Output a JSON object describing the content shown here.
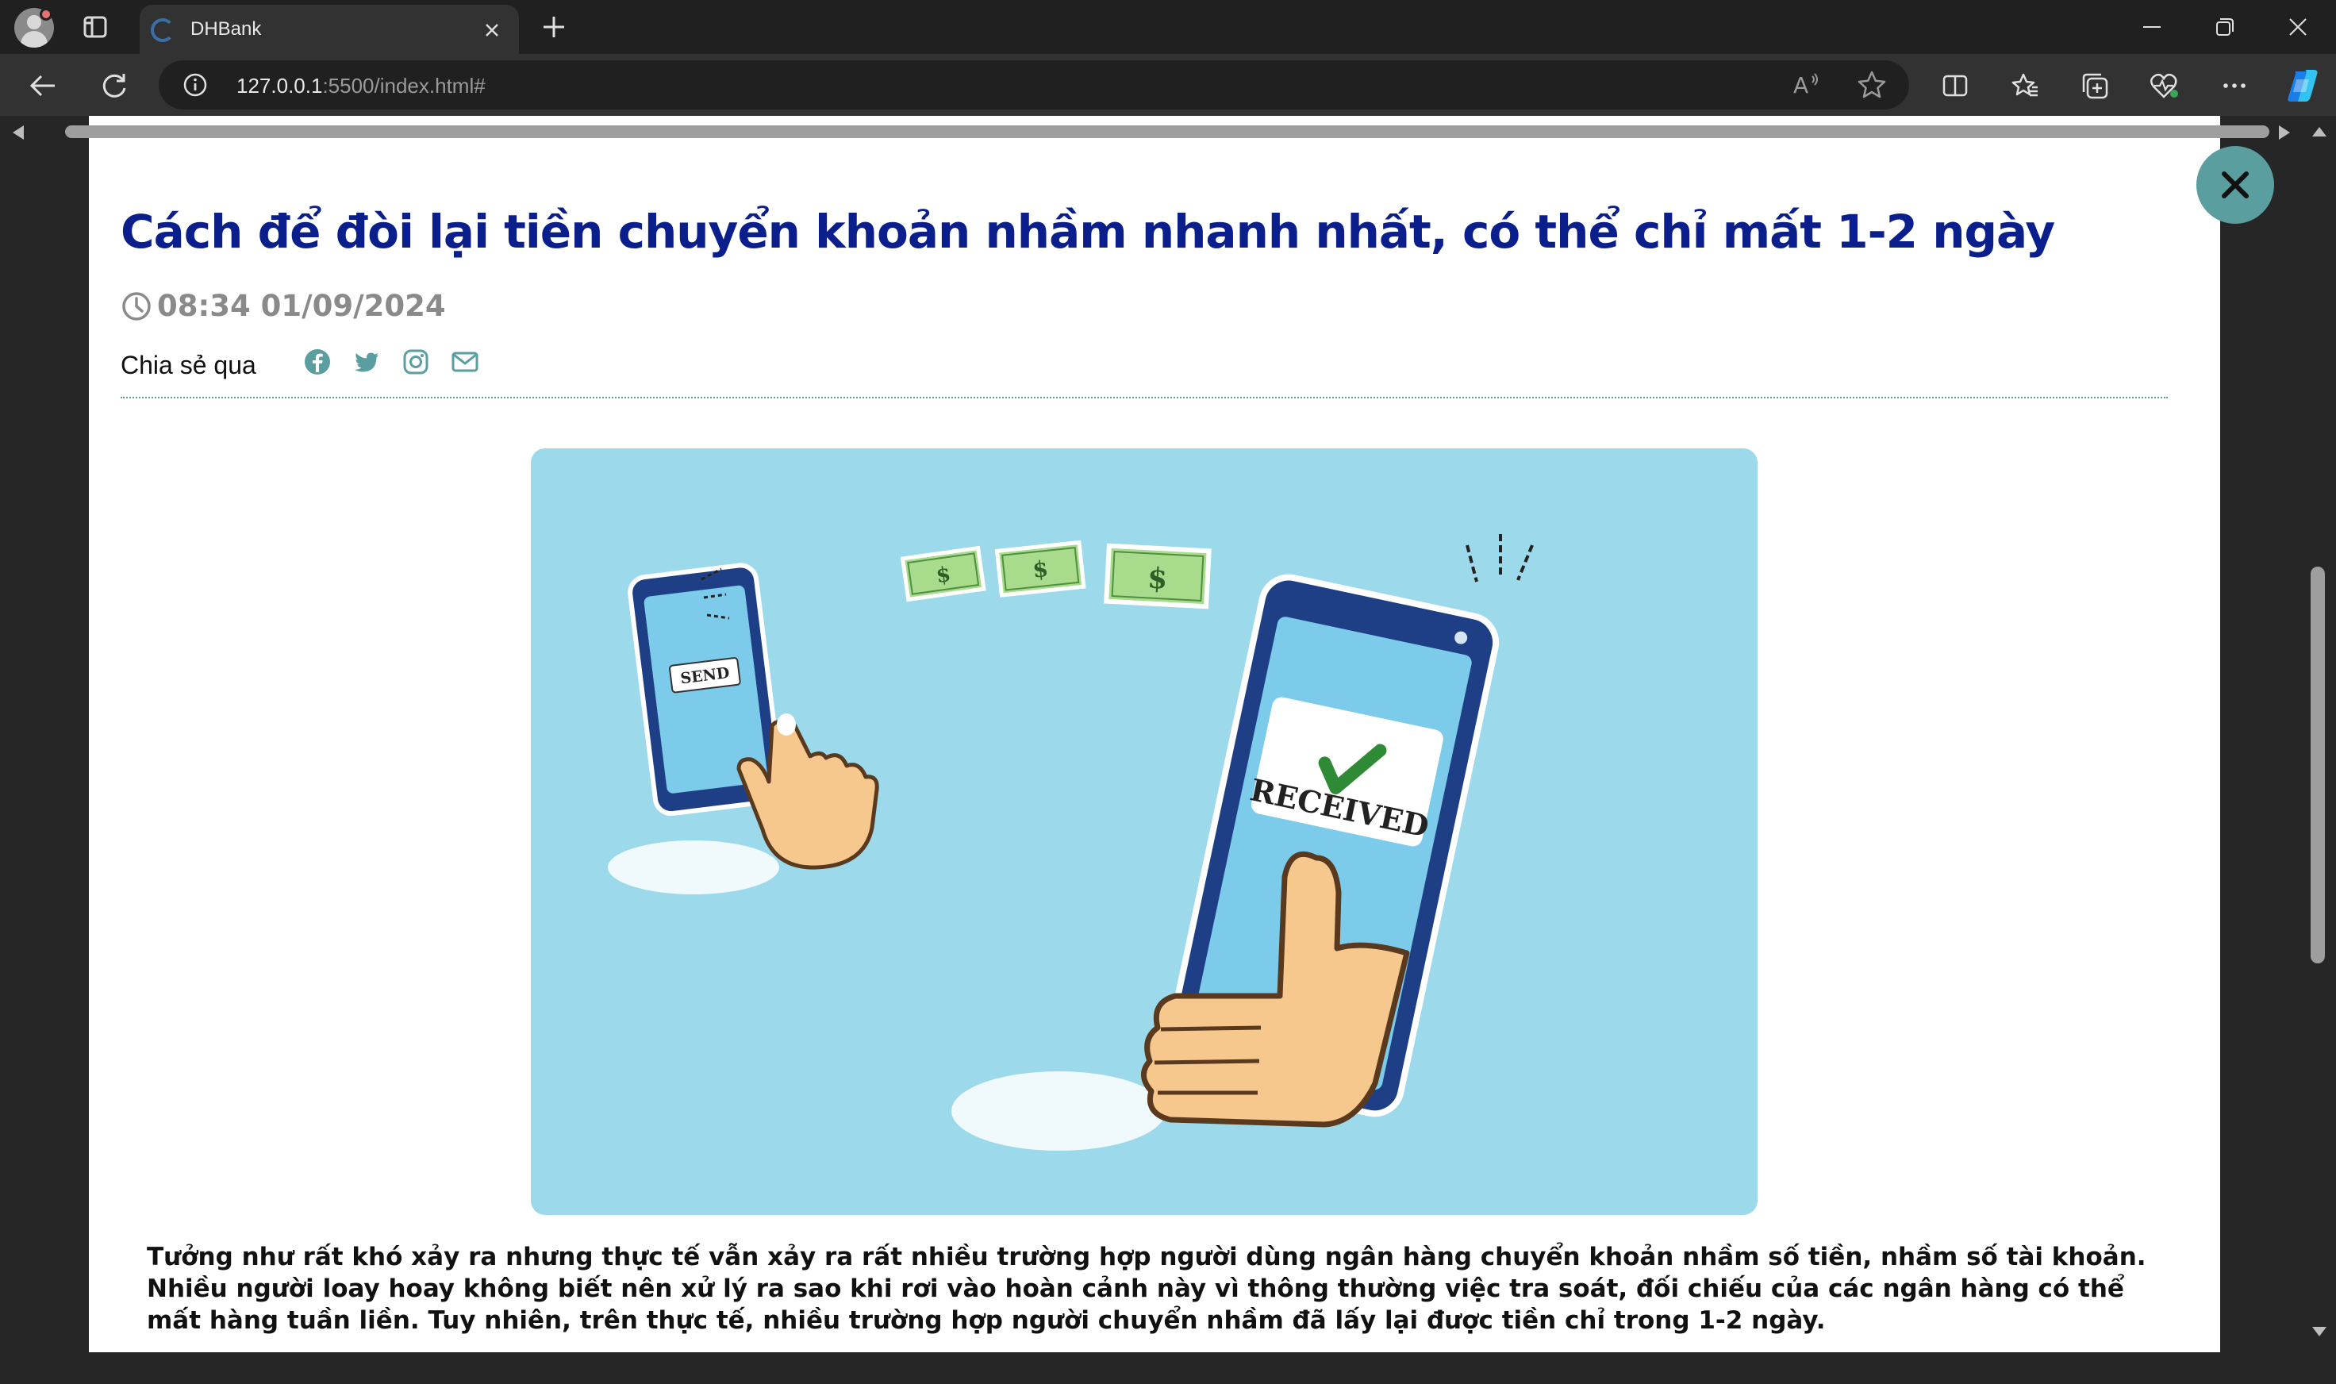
{
  "browser": {
    "tab_title": "DHBank",
    "url_host": "127.0.0.1",
    "url_rest": ":5500/index.html#",
    "read_aloud_label": "A",
    "icons": [
      "profile-icon",
      "tab-actions-icon",
      "tab-favicon",
      "close-tab-icon",
      "new-tab-icon",
      "minimize-icon",
      "maximize-icon",
      "close-window-icon",
      "back-icon",
      "reload-icon",
      "site-info-icon",
      "read-aloud-icon",
      "favorite-star-icon",
      "split-screen-icon",
      "favorites-icon",
      "collections-icon",
      "browser-essentials-icon",
      "more-icon",
      "copilot-icon"
    ]
  },
  "article": {
    "title": "Cách để đòi lại tiền chuyển khoản nhầm nhanh nhất, có thể chỉ mất 1-2 ngày",
    "datetime": "08:34 01/09/2024",
    "share_label": "Chia sẻ qua",
    "share_icons": [
      "facebook-icon",
      "twitter-icon",
      "instagram-icon",
      "mail-icon"
    ],
    "image": {
      "send_label": "SEND",
      "received_label": "RECEIVED"
    },
    "paragraph": "Tưởng như rất khó xảy ra nhưng thực tế vẫn xảy ra rất nhiều trường hợp người dùng ngân hàng chuyển khoản nhầm số tiền, nhầm số tài khoản. Nhiều người loay hoay không biết nên xử lý ra sao khi rơi vào hoàn cảnh này vì thông thường việc tra soát, đối chiếu của các ngân hàng có thể mất hàng tuần liền. Tuy nhiên, trên thực tế, nhiều trường hợp người chuyển nhầm đã lấy lại được tiền chỉ trong 1-2 ngày."
  },
  "colors": {
    "title": "#0a1e8c",
    "accent": "#5b9ea0",
    "date": "#8a8a8a",
    "hero_bg": "#9cd9ea"
  }
}
